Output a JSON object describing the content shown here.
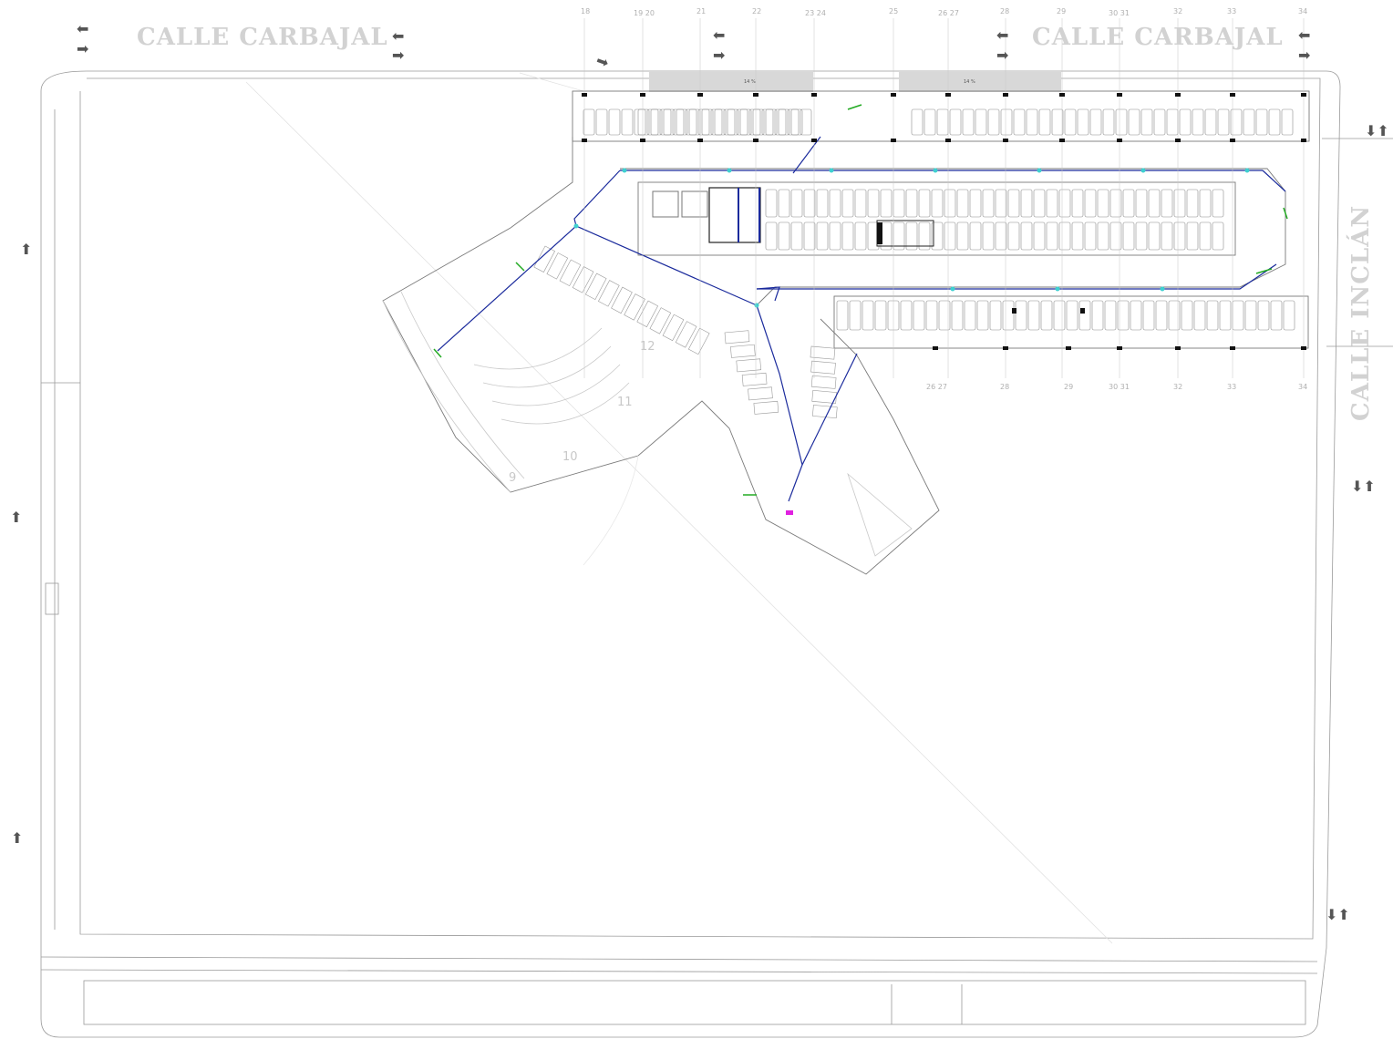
{
  "streets": {
    "top_left": "CALLE   CARBAJAL",
    "top_right": "CALLE   CARBAJAL",
    "right": "CALLE   INCLÁN"
  },
  "ramps": {
    "left": "14 %",
    "right": "14 %"
  },
  "grid_axes": {
    "top": [
      "18",
      "19 20",
      "21",
      "22",
      "23 24",
      "25",
      "26 27",
      "28",
      "29",
      "30 31",
      "32",
      "33",
      "34"
    ],
    "bottom": [
      "26 27",
      "28",
      "29",
      "30 31",
      "32",
      "33",
      "34"
    ]
  },
  "zones": [
    "12",
    "11",
    "10",
    "9"
  ],
  "colors": {
    "ink": "#6e6e6e",
    "light_ink": "#c4c4c4",
    "pipe": "#1a2a9c",
    "node": "#3fd0d0",
    "green": "#22aa22",
    "magenta": "#e020e0",
    "ramp_fill": "#d8d8d8"
  }
}
